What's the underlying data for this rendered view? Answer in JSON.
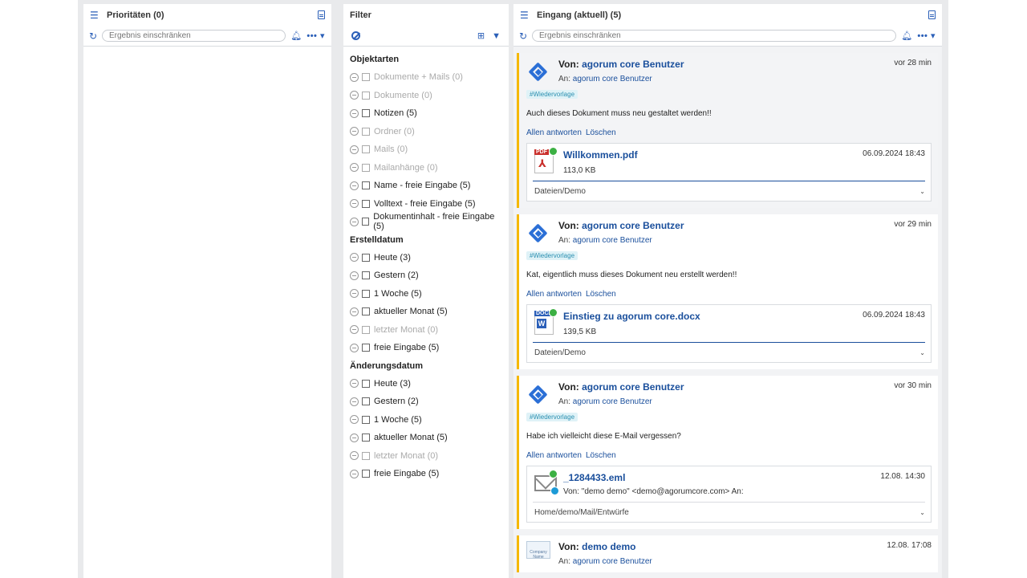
{
  "panel_left": {
    "title": "Prioritäten (0)",
    "search_placeholder": "Ergebnis einschränken"
  },
  "panel_filter": {
    "title": "Filter",
    "sections": [
      {
        "heading": "Objektarten",
        "items": [
          {
            "label": "Dokumente + Mails (0)",
            "enabled": false
          },
          {
            "label": "Dokumente (0)",
            "enabled": false
          },
          {
            "label": "Notizen (5)",
            "enabled": true
          },
          {
            "label": "Ordner (0)",
            "enabled": false
          },
          {
            "label": "Mails (0)",
            "enabled": false
          },
          {
            "label": "Mailanhänge (0)",
            "enabled": false
          },
          {
            "label": "Name - freie Eingabe (5)",
            "enabled": true
          },
          {
            "label": "Volltext - freie Eingabe (5)",
            "enabled": true
          },
          {
            "label": "Dokumentinhalt - freie Eingabe (5)",
            "enabled": true
          }
        ]
      },
      {
        "heading": "Erstelldatum",
        "items": [
          {
            "label": "Heute (3)",
            "enabled": true
          },
          {
            "label": "Gestern (2)",
            "enabled": true
          },
          {
            "label": "1 Woche (5)",
            "enabled": true
          },
          {
            "label": "aktueller Monat (5)",
            "enabled": true
          },
          {
            "label": "letzter Monat (0)",
            "enabled": false
          },
          {
            "label": "freie Eingabe (5)",
            "enabled": true
          }
        ]
      },
      {
        "heading": "Änderungsdatum",
        "items": [
          {
            "label": "Heute (3)",
            "enabled": true
          },
          {
            "label": "Gestern (2)",
            "enabled": true
          },
          {
            "label": "1 Woche (5)",
            "enabled": true
          },
          {
            "label": "aktueller Monat (5)",
            "enabled": true
          },
          {
            "label": "letzter Monat (0)",
            "enabled": false
          },
          {
            "label": "freie Eingabe (5)",
            "enabled": true
          }
        ]
      }
    ]
  },
  "panel_inbox": {
    "title": "Eingang (aktuell) (5)",
    "search_placeholder": "Ergebnis einschränken",
    "from_prefix": "Von:",
    "to_prefix": "An:",
    "messages": [
      {
        "from": "agorum core Benutzer",
        "to": "agorum core Benutzer",
        "time": "vor 28 min",
        "tag": "#Wiedervorlage",
        "body": "Auch dieses Dokument muss neu gestaltet werden!!",
        "reply_all": "Allen antworten",
        "delete": "Löschen",
        "attachment": {
          "type": "pdf",
          "type_label": "PDF",
          "name": "Willkommen.pdf",
          "size": "113,0 KB",
          "date": "06.09.2024 18:43",
          "path": "Dateien/Demo"
        }
      },
      {
        "from": "agorum core Benutzer",
        "to": "agorum core Benutzer",
        "time": "vor 29 min",
        "tag": "#Wiedervorlage",
        "body": "Kat, eigentlich muss dieses Dokument neu erstellt werden!!",
        "reply_all": "Allen antworten",
        "delete": "Löschen",
        "attachment": {
          "type": "docx",
          "type_label": "DOCX",
          "name": "Einstieg zu agorum core.docx",
          "size": "139,5 KB",
          "date": "06.09.2024 18:43",
          "path": "Dateien/Demo"
        }
      },
      {
        "from": "agorum core Benutzer",
        "to": "agorum core Benutzer",
        "time": "vor 30 min",
        "tag": "#Wiedervorlage",
        "body": "Habe ich vielleicht diese E-Mail vergessen?",
        "reply_all": "Allen antworten",
        "delete": "Löschen",
        "attachment": {
          "type": "eml",
          "name": "_1284433.eml",
          "subline": "Von: \"demo demo\" <demo@agorumcore.com>  An:",
          "date": "12.08. 14:30",
          "path": "Home/demo/Mail/Entwürfe"
        }
      },
      {
        "from": "demo demo",
        "to": "agorum core Benutzer",
        "time": "12.08. 17:08",
        "avatar_text": "Company Name"
      }
    ]
  },
  "colors": {
    "accent": "#2b5fb8",
    "link": "#1a4f9c",
    "stripe": "#f5b800",
    "tag_bg": "#dff2f7"
  }
}
